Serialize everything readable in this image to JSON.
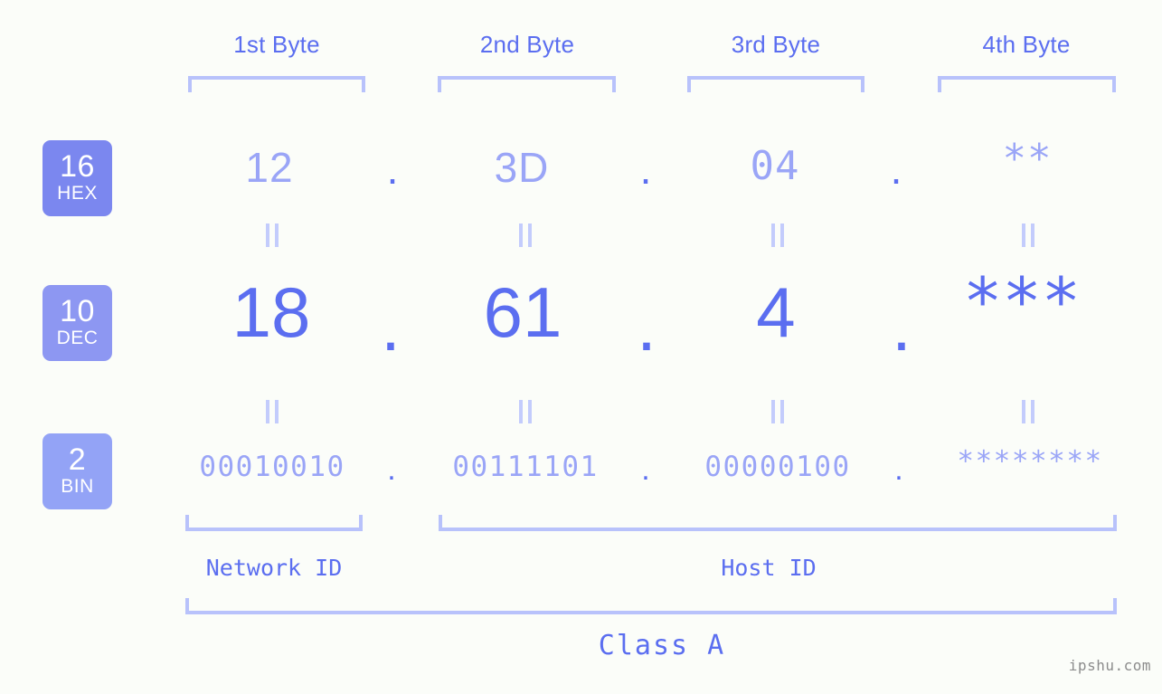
{
  "byte_headers": [
    {
      "label": "1st Byte"
    },
    {
      "label": "2nd Byte"
    },
    {
      "label": "3rd Byte"
    },
    {
      "label": "4th Byte"
    }
  ],
  "bases": [
    {
      "num": "16",
      "label": "HEX",
      "color": "#7b87ef"
    },
    {
      "num": "10",
      "label": "DEC",
      "color": "#8d97f2"
    },
    {
      "num": "2",
      "label": "BIN",
      "color": "#93a3f6"
    }
  ],
  "rows": {
    "hex": {
      "base": "16",
      "name": "HEX",
      "values": [
        "12",
        "3D",
        "04",
        "**"
      ],
      "separator": "."
    },
    "dec": {
      "base": "10",
      "name": "DEC",
      "values": [
        "18",
        "61",
        "4",
        "***"
      ],
      "separator": "."
    },
    "bin": {
      "base": "2",
      "name": "BIN",
      "values": [
        "00010010",
        "00111101",
        "00000100",
        "********"
      ],
      "separator": "."
    }
  },
  "segments": {
    "network_id": "Network ID",
    "host_id": "Host ID",
    "class": "Class A"
  },
  "watermark": "ipshu.com",
  "colors": {
    "background": "#fbfdf9",
    "accent_strong": "#5b6ef0",
    "accent_mid": "#9aa5f7",
    "accent_light": "#b8c2fb",
    "eq_mark": "#c3ccfc",
    "watermark": "#8c8c8c"
  }
}
